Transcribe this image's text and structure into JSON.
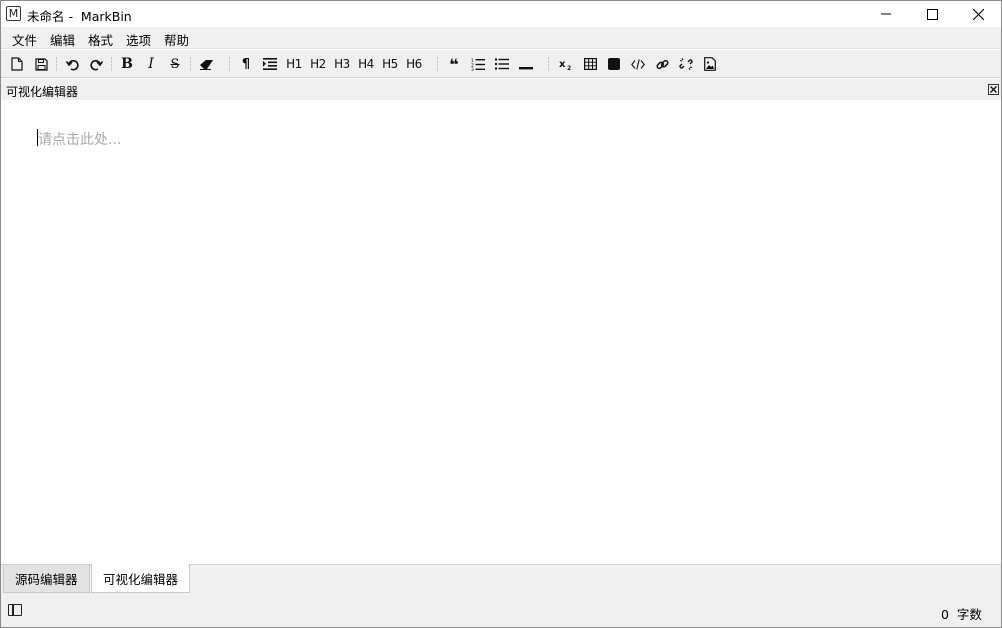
{
  "window": {
    "app_icon_letter": "M",
    "title": "未命名 -  MarkBin"
  },
  "menu": {
    "items": [
      "文件",
      "编辑",
      "格式",
      "选项",
      "帮助"
    ]
  },
  "toolbar": {
    "h1": "H1",
    "h2": "H2",
    "h3": "H3",
    "h4": "H4",
    "h5": "H5",
    "h6": "H6",
    "bold": "B",
    "italic": "I",
    "strike": "S",
    "pilcrow": "¶",
    "quote": "❝"
  },
  "panel": {
    "title": "可视化编辑器"
  },
  "editor": {
    "placeholder": "请点击此处..."
  },
  "tabs": [
    {
      "label": "源码编辑器",
      "active": false
    },
    {
      "label": "可视化编辑器",
      "active": true
    }
  ],
  "status": {
    "word_count": "0  字数"
  }
}
